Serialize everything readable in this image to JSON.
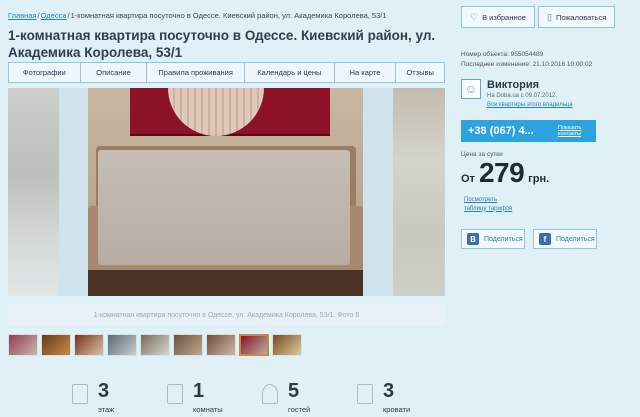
{
  "breadcrumb": {
    "home": "Главная",
    "city": "Одесса",
    "current": "1-комнатная квартира посуточно в Одессе. Киевский район, ул. Академика Королева, 53/1"
  },
  "title": "1-комнатная квартира посуточно в Одессе. Киевский район, ул. Академика Королева, 53/1",
  "tabs": [
    {
      "label": "Фотографии"
    },
    {
      "label": "Описание"
    },
    {
      "label": "Правила проживания"
    },
    {
      "label": "Календарь и цены"
    },
    {
      "label": "На карте"
    },
    {
      "label": "Отзывы"
    }
  ],
  "gallery": {
    "caption": "1-комнатная квартира посуточно в Одессе, ул. Академика Королева, 53/1. Фото 8",
    "thumbnails": [
      {
        "colors": [
          "#9a3b56",
          "#c8b7a6"
        ]
      },
      {
        "colors": [
          "#6b3a1e",
          "#c88a40"
        ]
      },
      {
        "colors": [
          "#7a2e1a",
          "#d9c4a8"
        ]
      },
      {
        "colors": [
          "#5a6a70",
          "#c8ccd0"
        ]
      },
      {
        "colors": [
          "#7a6a5a",
          "#d8d8d0"
        ]
      },
      {
        "colors": [
          "#6a5040",
          "#c0a888"
        ]
      },
      {
        "colors": [
          "#7a4a3a",
          "#c9b8a5"
        ]
      },
      {
        "colors": [
          "#8c1228",
          "#b7ada4"
        ]
      },
      {
        "colors": [
          "#7a4a20",
          "#e0c8a0"
        ]
      }
    ],
    "active_thumbnail_index": 7
  },
  "features": [
    {
      "icon": "building-icon",
      "value": "3",
      "label": "этаж"
    },
    {
      "icon": "door-icon",
      "value": "1",
      "label": "комнаты"
    },
    {
      "icon": "guests-icon",
      "value": "5",
      "label": "гостей"
    },
    {
      "icon": "bed-icon",
      "value": "3",
      "label": "кровати"
    }
  ],
  "actions": {
    "favorite_label": "В избранное",
    "complain_label": "Пожаловаться"
  },
  "meta": {
    "object_number": "Номер объекта: 955054489",
    "last_modified": "Последнее изменение: 21.10.2016 10:00:02"
  },
  "owner": {
    "name": "Виктория",
    "since": "На Doba.ua с 09.07.2012,",
    "more_link": "Все квартиры этого владельца"
  },
  "phone": {
    "number": "+38 (067) 4...",
    "show_label": "Показать контакты"
  },
  "price": {
    "label": "Цена за сутки",
    "from": "От",
    "amount": "279",
    "currency": "грн."
  },
  "tariff_link": [
    "Посмотреть",
    "таблицу тарифов"
  ],
  "share": {
    "vk_label": "Поделиться",
    "fb_label": "Поделиться"
  },
  "colors": {
    "accent": "#2ea2de",
    "link": "#2a7fc0",
    "background": "#dff0f7",
    "border": "#8fc6e0"
  }
}
